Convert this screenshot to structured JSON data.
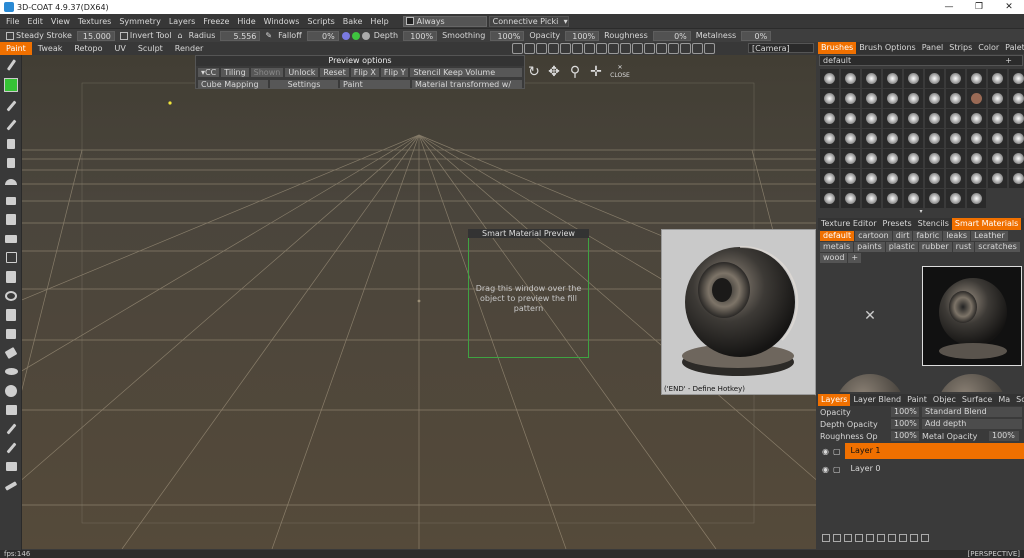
{
  "window": {
    "title": "3D-COAT 4.9.37(DX64)",
    "controls": [
      "—",
      "❐",
      "✕"
    ]
  },
  "menu": {
    "items": [
      "File",
      "Edit",
      "View",
      "Textures",
      "Symmetry",
      "Layers",
      "Freeze",
      "Hide",
      "Windows",
      "Scripts",
      "Bake",
      "Help"
    ],
    "always_label": "Always",
    "picker_label": "Connective Picki"
  },
  "toolbar": {
    "steady_stroke_label": "Steady Stroke",
    "steady_stroke_value": "15.000",
    "invert_tool_label": "Invert Tool",
    "radius_label": "Radius",
    "radius_value": "5.556",
    "falloff_label": "Falloff",
    "falloff_value": "0%",
    "depth_label": "Depth",
    "depth_value": "100%",
    "smoothing_label": "Smoothing",
    "smoothing_value": "100%",
    "opacity_label": "Opacity",
    "opacity_value": "100%",
    "roughness_label": "Roughness",
    "roughness_value": "0%",
    "metalness_label": "Metalness",
    "metalness_value": "0%"
  },
  "modes": {
    "tabs": [
      "Paint",
      "Tweak",
      "Retopo",
      "UV",
      "Sculpt",
      "Render"
    ],
    "active": "Paint",
    "camera": "[Camera]"
  },
  "preview_options": {
    "title": "Preview options",
    "row1": [
      "▾CC",
      "Tiling",
      "Shown",
      "Unlock",
      "Reset",
      "Flip X",
      "Flip Y",
      "Stencil Keep Volume"
    ],
    "row2": [
      "Cube Mapping",
      "Settings",
      "Paint",
      "Material transformed w/"
    ],
    "close": "CLOSE"
  },
  "smart_preview": {
    "title": "Smart Material Preview",
    "text": "Drag this window over the object to preview the fill pattern"
  },
  "render_preview": {
    "hotkey_label": "('END' - Define Hotkey)"
  },
  "brushes": {
    "tabs": [
      "Brushes",
      "Brush Options",
      "Panel",
      "Strips",
      "Color",
      "Palette"
    ],
    "active": "Brushes",
    "preset": "default"
  },
  "materials": {
    "tabs": [
      "Texture Editor",
      "Presets",
      "Stencils",
      "Smart Materials"
    ],
    "active": "Smart Materials",
    "tags": [
      "default",
      "cartoon",
      "dirt",
      "fabric",
      "leaks",
      "Leather",
      "metals",
      "paints",
      "plastic",
      "rubber",
      "rust",
      "scratches",
      "wood",
      "+"
    ],
    "active_tag": "default"
  },
  "layers": {
    "tabs": [
      "Layers",
      "Layer Blend",
      "Paint",
      "Objec",
      "Surface",
      "Ma",
      "SculptTree"
    ],
    "active": "Layers",
    "opacity_label": "Opacity",
    "opacity_value": "100%",
    "blend_mode": "Standard Blend",
    "depth_opacity_label": "Depth Opacity",
    "depth_opacity_value": "100%",
    "depth_mode": "Add depth",
    "roughness_op_label": "Roughness Op",
    "roughness_op_value": "100%",
    "metal_opacity_label": "Metal Opacity",
    "metal_opacity_value": "100%",
    "items": [
      {
        "name": "Layer 1",
        "active": true
      },
      {
        "name": "Layer 0",
        "active": false
      }
    ]
  },
  "status": {
    "fps": "fps:146",
    "view": "[PERSPECTIVE]"
  },
  "colors": {
    "accent": "#f07000",
    "primary_color": "#36c236"
  }
}
